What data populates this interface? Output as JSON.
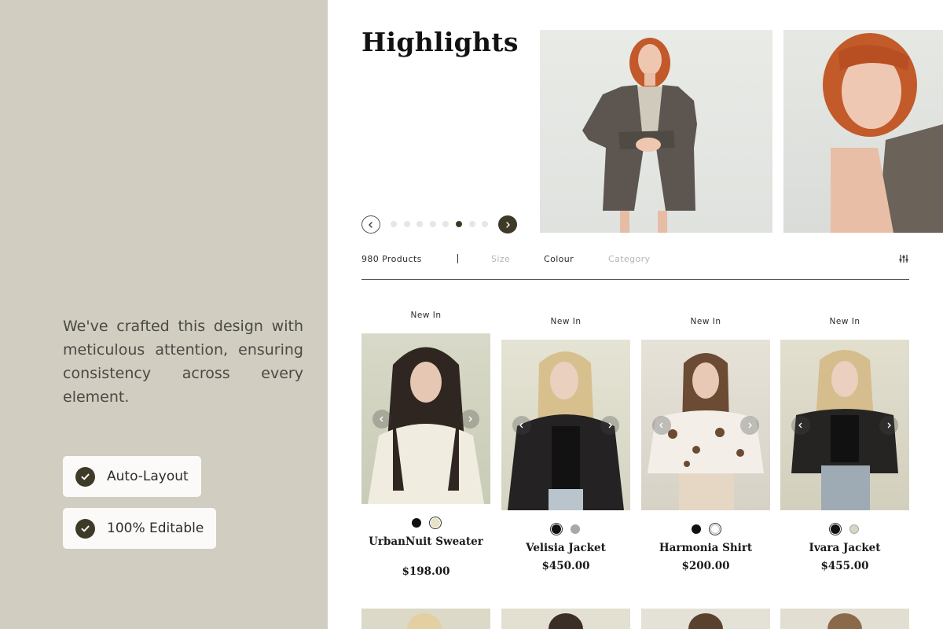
{
  "left_panel": {
    "tagline": "We've crafted this design with meticulous attention, ensuring consistency across every element.",
    "features": [
      "Auto-Layout",
      "100% Editable"
    ]
  },
  "highlights": {
    "title": "Highlights",
    "slider": {
      "total_dots": 8,
      "active_index": 5
    }
  },
  "filter_bar": {
    "product_count": "980 Products",
    "filters": [
      "Size",
      "Colour",
      "Category"
    ],
    "active_filter": "Colour"
  },
  "products": [
    {
      "badge": "New In",
      "name": "UrbanNuit Sweater",
      "price": "$198.00",
      "colors": [
        "#111111",
        "#e6e2c6"
      ],
      "selected_color": 1
    },
    {
      "badge": "New In",
      "name": "Velisia Jacket",
      "price": "$450.00",
      "colors": [
        "#111111",
        "#a8a8a8"
      ],
      "selected_color": 0
    },
    {
      "badge": "New In",
      "name": "Harmonia Shirt",
      "price": "$200.00",
      "colors": [
        "#111111",
        "#ffffff"
      ],
      "selected_color": 1
    },
    {
      "badge": "New In",
      "name": "Ivara Jacket",
      "price": "$455.00",
      "colors": [
        "#111111",
        "#d6d8c6"
      ],
      "selected_color": 0
    }
  ],
  "colors": {
    "left_panel_bg": "#d1cdc0",
    "accent_dark": "#3f3a27",
    "text_primary": "#1a1a1a",
    "muted_filter": "#b5b5b5"
  },
  "icons": {
    "feature_check": "check-circle-icon",
    "slider_prev": "chevron-left-icon",
    "slider_next": "chevron-right-icon",
    "filter": "sliders-icon"
  }
}
